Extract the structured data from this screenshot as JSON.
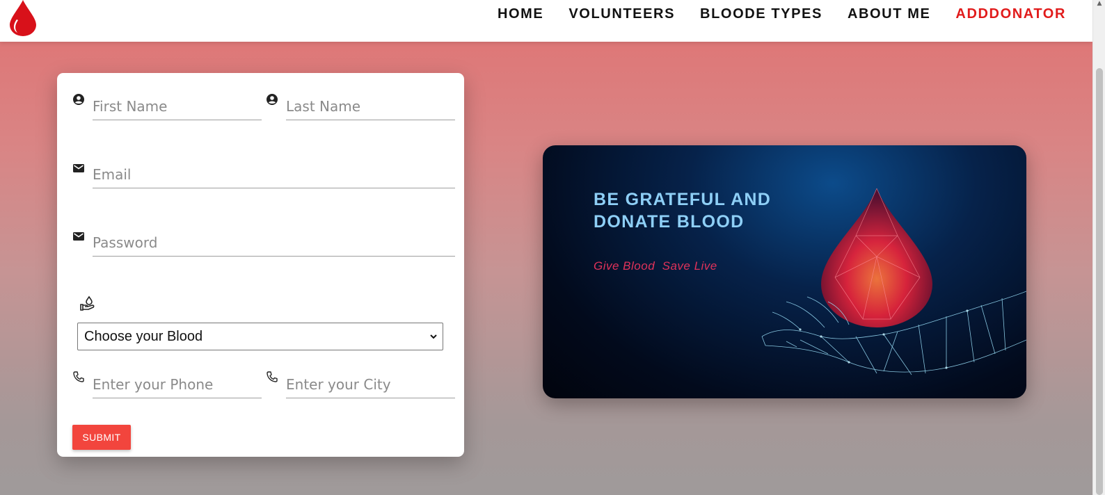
{
  "nav": {
    "logo": "blood-drop-logo",
    "links": [
      "HOME",
      "VOLUNTEERS",
      "BLOODE TYPES",
      "ABOUT ME",
      "ADDDONATOR"
    ],
    "active_color": "#e11b1b"
  },
  "form": {
    "first_name_placeholder": "First Name",
    "last_name_placeholder": "Last Name",
    "email_placeholder": "Email",
    "password_placeholder": "Password",
    "blood_select_value": "Choose your Blood",
    "phone_placeholder": "Enter your Phone",
    "city_placeholder": "Enter your City",
    "submit_label": "SUBMIT",
    "submit_color": "#f2453d"
  },
  "banner": {
    "title": "BE GRATEFUL AND DONATE BLOOD",
    "subtitle": "Give Blood  Save Live"
  }
}
